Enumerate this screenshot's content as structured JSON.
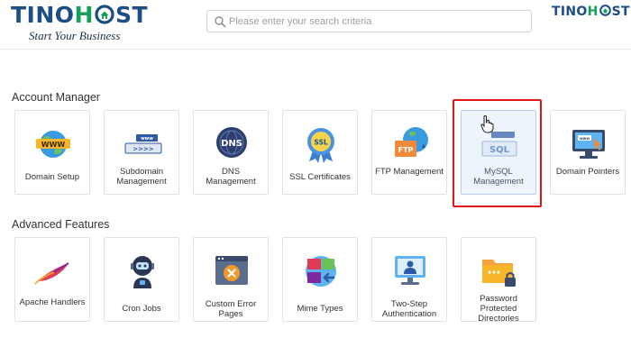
{
  "header": {
    "logo": {
      "part1": "TINO",
      "part2": "H",
      "part3": "ST"
    },
    "tagline": "Start Your Business",
    "search": {
      "placeholder": "Please enter your search criteria",
      "value": ""
    },
    "logo_right": {
      "part1": "TINO",
      "part2": "H",
      "part3": "ST"
    }
  },
  "sections": {
    "account": {
      "title": "Account Manager",
      "tiles": [
        {
          "label": "Domain Setup",
          "icon": "www-globe-icon"
        },
        {
          "label": "Subdomain Management",
          "icon": "subdomain-icon"
        },
        {
          "label": "DNS Management",
          "icon": "dns-icon"
        },
        {
          "label": "SSL Certificates",
          "icon": "ssl-badge-icon"
        },
        {
          "label": "FTP Management",
          "icon": "ftp-icon"
        },
        {
          "label": "MySQL Management",
          "icon": "mysql-icon",
          "selected": true
        },
        {
          "label": "Domain Pointers",
          "icon": "domain-pointer-icon"
        }
      ]
    },
    "advanced": {
      "title": "Advanced Features",
      "tiles": [
        {
          "label": "Apache Handlers",
          "icon": "apache-feather-icon"
        },
        {
          "label": "Cron Jobs",
          "icon": "robot-icon"
        },
        {
          "label": "Custom Error Pages",
          "icon": "error-page-icon"
        },
        {
          "label": "Mime Types",
          "icon": "mime-types-icon"
        },
        {
          "label": "Two-Step Authentication",
          "icon": "two-step-auth-icon"
        },
        {
          "label": "Password Protected Directories",
          "icon": "locked-folder-icon"
        }
      ]
    }
  },
  "colors": {
    "brand_blue": "#1d4f86",
    "brand_green": "#15a05a",
    "highlight_red": "#e01515",
    "selected_tile_bg": "#eef4fb"
  }
}
